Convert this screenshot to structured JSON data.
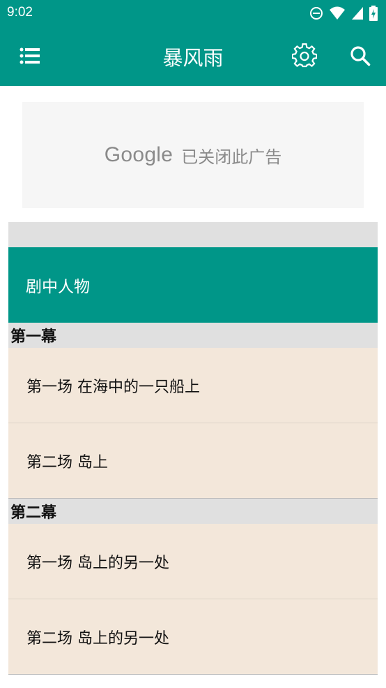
{
  "status_bar": {
    "time": "9:02"
  },
  "app_bar": {
    "title": "暴风雨",
    "menu_icon": "list-menu-icon",
    "settings_icon": "gear-icon",
    "search_icon": "search-icon"
  },
  "ad": {
    "logo": "Google",
    "text": "已关闭此广告"
  },
  "characters": {
    "label": "剧中人物"
  },
  "acts": [
    {
      "title": "第一幕",
      "scenes": [
        {
          "label": "第一场 在海中的一只船上"
        },
        {
          "label": "第二场 岛上"
        }
      ]
    },
    {
      "title": "第二幕",
      "scenes": [
        {
          "label": "第一场 岛上的另一处"
        },
        {
          "label": "第二场 岛上的另一处"
        }
      ]
    }
  ],
  "colors": {
    "primary": "#009688",
    "row_bg": "#f3e7da",
    "section_bg": "#e0e0e0"
  }
}
